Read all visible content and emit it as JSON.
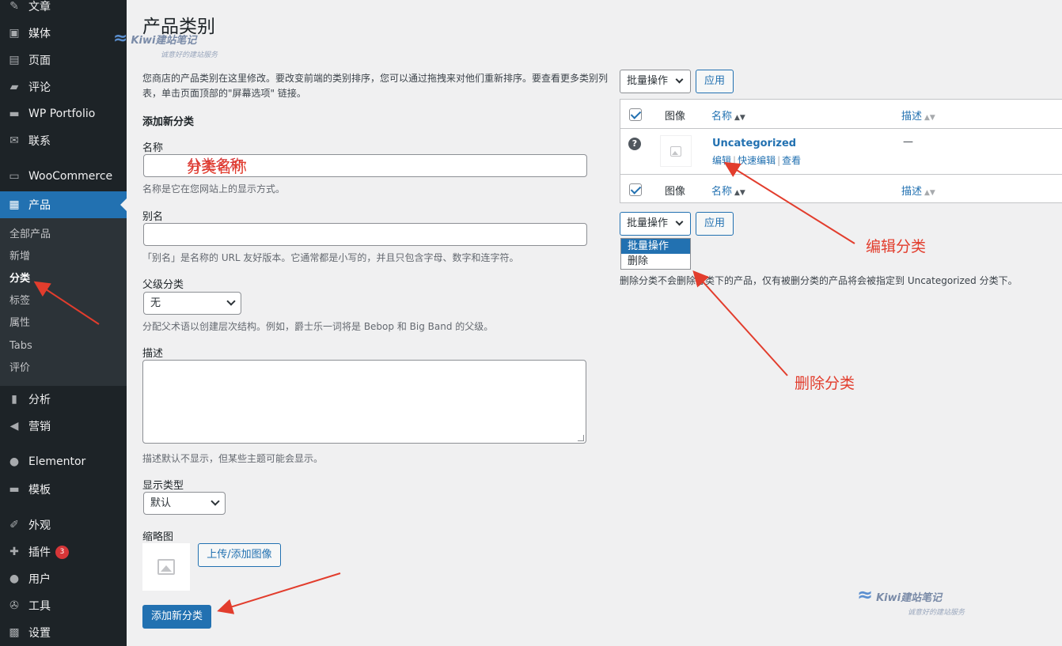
{
  "sidebar": {
    "items": [
      {
        "label": "文章",
        "icon": "pin-icon"
      },
      {
        "label": "媒体",
        "icon": "media-icon"
      },
      {
        "label": "页面",
        "icon": "page-icon"
      },
      {
        "label": "评论",
        "icon": "comment-icon"
      },
      {
        "label": "WP Portfolio",
        "icon": "folder-icon"
      },
      {
        "label": "联系",
        "icon": "mail-icon"
      },
      {
        "label": "WooCommerce",
        "icon": "woo-icon"
      },
      {
        "label": "产品",
        "icon": "archive-icon"
      },
      {
        "label": "分析",
        "icon": "bar-chart-icon"
      },
      {
        "label": "营销",
        "icon": "megaphone-icon"
      },
      {
        "label": "Elementor",
        "icon": "elementor-icon"
      },
      {
        "label": "模板",
        "icon": "folder-icon"
      },
      {
        "label": "外观",
        "icon": "brush-icon"
      },
      {
        "label": "插件",
        "icon": "plugin-icon",
        "badge": "3"
      },
      {
        "label": "用户",
        "icon": "user-icon"
      },
      {
        "label": "工具",
        "icon": "wrench-icon"
      },
      {
        "label": "设置",
        "icon": "settings-icon"
      }
    ],
    "submenu": [
      "全部产品",
      "新增",
      "分类",
      "标签",
      "属性",
      "Tabs",
      "评价"
    ]
  },
  "page": {
    "title": "产品类别",
    "intro": "您商店的产品类别在这里修改。要改变前端的类别排序，您可以通过拖拽来对他们重新排序。要查看更多类别列表，单击页面顶部的\"屏幕选项\" 链接。"
  },
  "watermark": {
    "title": "Kiwi建站笔记",
    "subtitle": "诚意好的建站服务"
  },
  "form": {
    "heading": "添加新分类",
    "name_label": "名称",
    "name_value": "分类名称",
    "name_desc": "名称是它在您网站上的显示方式。",
    "slug_label": "别名",
    "slug_desc": "「别名」是名称的 URL 友好版本。它通常都是小写的，并且只包含字母、数字和连字符。",
    "parent_label": "父级分类",
    "parent_value": "无",
    "parent_desc": "分配父术语以创建层次结构。例如，爵士乐一词将是 Bebop 和 Big Band 的父级。",
    "desc_label": "描述",
    "desc_desc": "描述默认不显示，但某些主题可能会显示。",
    "display_label": "显示类型",
    "display_value": "默认",
    "thumb_label": "缩略图",
    "upload_button": "上传/添加图像",
    "submit_button": "添加新分类"
  },
  "table": {
    "bulk_label": "批量操作",
    "apply_label": "应用",
    "col_image": "图像",
    "col_name": "名称",
    "col_desc": "描述",
    "row": {
      "name": "Uncategorized",
      "action_edit": "编辑",
      "action_quick": "快速编辑",
      "action_view": "查看",
      "description": "—"
    },
    "dropdown_options": [
      "批量操作",
      "删除"
    ],
    "delete_note": "删除分类不会删除分类下的产品，仅有被删分类的产品将会被指定到 Uncategorized 分类下。"
  },
  "annotations": {
    "name_hint": "分类名称",
    "edit_hint": "编辑分类",
    "delete_hint": "删除分类"
  },
  "colors": {
    "accent": "#2271b1",
    "sidebar": "#1d2327",
    "annotation": "#e23d2d"
  }
}
